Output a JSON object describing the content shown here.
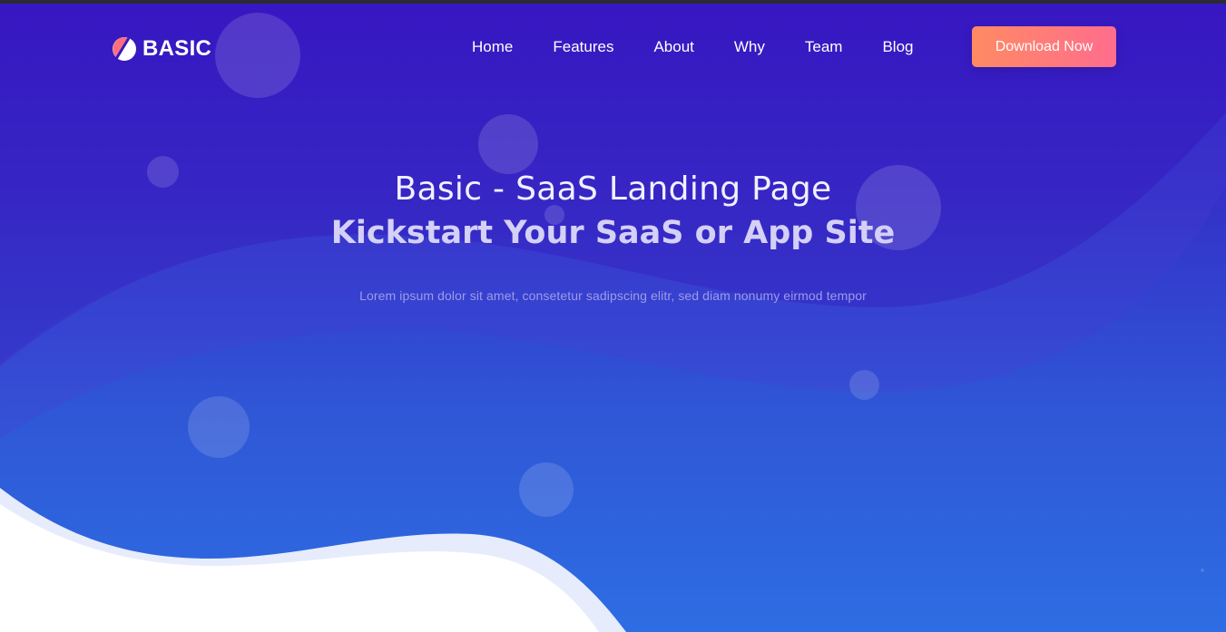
{
  "brand": {
    "name": "BASIC",
    "logo_icon": "half-circle-logo-icon"
  },
  "nav": {
    "items": [
      {
        "label": "Home"
      },
      {
        "label": "Features"
      },
      {
        "label": "About"
      },
      {
        "label": "Why"
      },
      {
        "label": "Team"
      },
      {
        "label": "Blog"
      }
    ],
    "cta_label": "Download Now"
  },
  "hero": {
    "title": "Basic - SaaS Landing Page",
    "subtitle": "Kickstart Your SaaS or App Site",
    "description": "Lorem ipsum dolor sit amet, consetetur sadipscing elitr, sed diam nonumy eirmod tempor"
  },
  "colors": {
    "hero_top": "#3519c4",
    "hero_bottom": "#2e6de3",
    "cta_start": "#ff8a63",
    "cta_end": "#ff6d8d",
    "wave_light": "#e6ecfb",
    "wave_white": "#ffffff"
  }
}
